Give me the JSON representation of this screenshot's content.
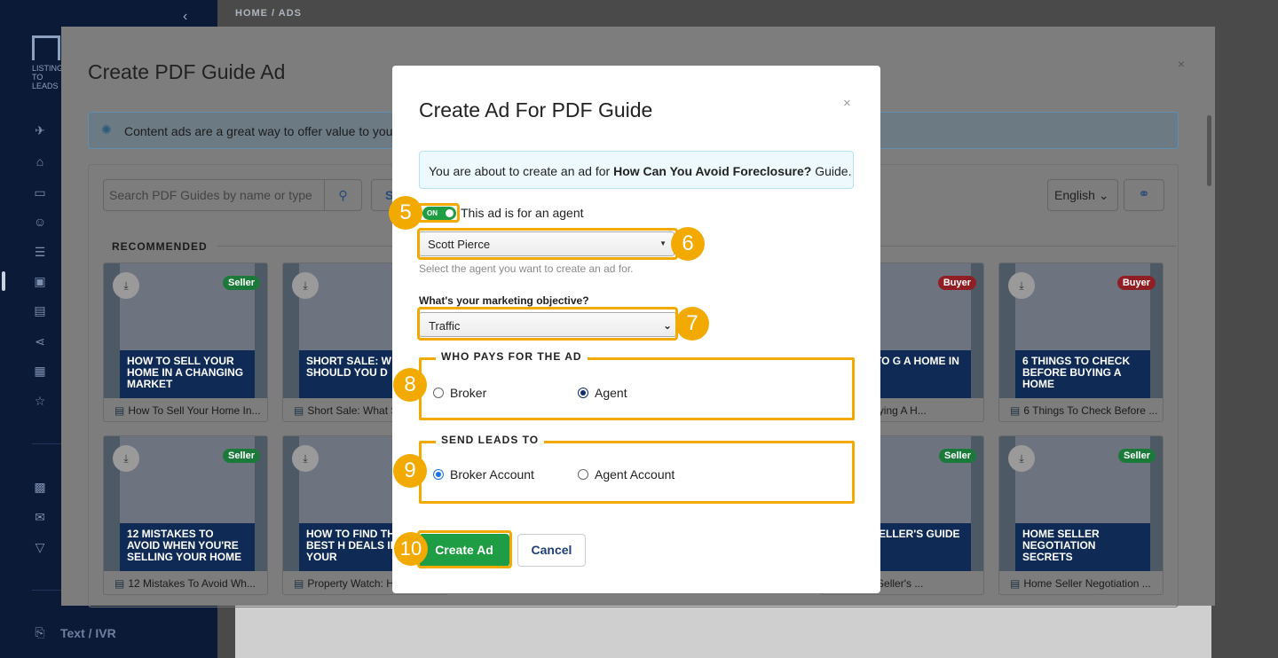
{
  "app": {
    "breadcrumb": "HOME  /  ADS",
    "logo_text": "LISTING TO LEADS",
    "sidebar_text_ivr": "Text / IVR"
  },
  "big_modal": {
    "title": "Create PDF Guide Ad",
    "close": "×",
    "info": "Content ads are a great way to offer value to you",
    "search_placeholder": "Search PDF Guides by name or type",
    "search_extra": "S",
    "language": "English",
    "recommended": "RECOMMENDED",
    "cards_row1": [
      {
        "banner": "HOW TO SELL YOUR HOME IN A CHANGING MARKET",
        "caption": "How To Sell Your Home In...",
        "badge": "Seller"
      },
      {
        "banner": "SHORT SALE: W SHOULD YOU D",
        "caption": "Short Sale: What S",
        "badge": ""
      },
      {
        "banner": "CRET TO G A HOME IN EASON",
        "caption": "cret To Buying A H...",
        "badge": "Buyer"
      },
      {
        "banner": "6 THINGS TO CHECK BEFORE BUYING A HOME",
        "caption": "6 Things To Check Before ...",
        "badge": "Buyer"
      }
    ],
    "cards_row2": [
      {
        "banner": "12 MISTAKES TO AVOID WHEN YOU'RE SELLING YOUR HOME",
        "caption": "12 Mistakes To Avoid Wh...",
        "badge": "Seller"
      },
      {
        "banner": "HOW TO FIND THE BEST H DEALS IN YOUR",
        "caption": "Property Watch: H",
        "badge": ""
      },
      {
        "banner": "TIME SELLER'S GUIDE",
        "caption": "ne Home Seller's ...",
        "badge": "Seller"
      },
      {
        "banner": "HOME SELLER NEGOTIATION SECRETS",
        "caption": "Home Seller Negotiation ...",
        "badge": "Seller"
      }
    ]
  },
  "modal": {
    "title": "Create Ad For PDF Guide",
    "close": "×",
    "info_prefix": "You are about to create an ad for ",
    "info_guide": "How Can You Avoid Foreclosure?",
    "info_suffix": " Guide.",
    "toggle_state": "ON",
    "toggle_label": "This ad is for an agent",
    "agent_selected": "Scott Pierce",
    "agent_help": "Select the agent you want to create an ad for.",
    "objective_label": "What's your marketing objective?",
    "objective_selected": "Traffic",
    "who_pays": {
      "legend": "WHO PAYS FOR THE AD",
      "options": [
        "Broker",
        "Agent"
      ],
      "selected": "Agent"
    },
    "send_leads": {
      "legend": "SEND LEADS TO",
      "options": [
        "Broker Account",
        "Agent Account"
      ],
      "selected": "Broker Account"
    },
    "create_label": "Create Ad",
    "cancel_label": "Cancel"
  },
  "steps": [
    "5",
    "6",
    "7",
    "8",
    "9",
    "10"
  ],
  "colors": {
    "highlight": "#f2a900",
    "primary_green": "#1f9d44",
    "navy": "#0b1a36"
  }
}
